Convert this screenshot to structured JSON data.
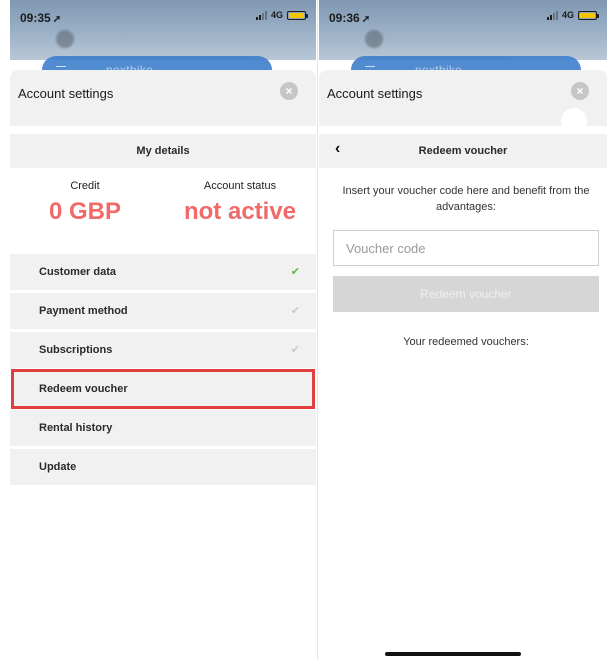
{
  "left_screen": {
    "status_bar": {
      "time": "09:35",
      "network": "4G"
    },
    "app_bar": {
      "brand": "nextbike"
    },
    "sheet": {
      "title": "Account settings",
      "close_icon": "close-icon"
    },
    "subheader": {
      "title": "My details"
    },
    "stats": {
      "credit": {
        "label": "Credit",
        "value": "0 GBP"
      },
      "status": {
        "label": "Account status",
        "value": "not active"
      }
    },
    "menu": [
      {
        "label": "Customer data",
        "check": "active"
      },
      {
        "label": "Payment method",
        "check": "inactive"
      },
      {
        "label": "Subscriptions",
        "check": "inactive"
      },
      {
        "label": "Redeem voucher",
        "highlighted": true
      },
      {
        "label": "Rental history"
      },
      {
        "label": "Update"
      }
    ]
  },
  "right_screen": {
    "status_bar": {
      "time": "09:36",
      "network": "4G"
    },
    "app_bar": {
      "brand": "nextbike"
    },
    "sheet": {
      "title": "Account settings",
      "close_icon": "close-icon"
    },
    "subheader": {
      "title": "Redeem voucher",
      "back_icon": "chevron-left-icon"
    },
    "intro": "Insert your voucher code here and benefit from the advantages:",
    "voucher_input": {
      "placeholder": "Voucher code",
      "value": ""
    },
    "redeem_button": "Redeem voucher",
    "redeemed_label": "Your redeemed vouchers:"
  },
  "colors": {
    "accent_red": "#f06a6a",
    "highlight_red": "#e23e3e",
    "check_green": "#5dbb3f",
    "brand_blue": "#3f7fcb"
  }
}
